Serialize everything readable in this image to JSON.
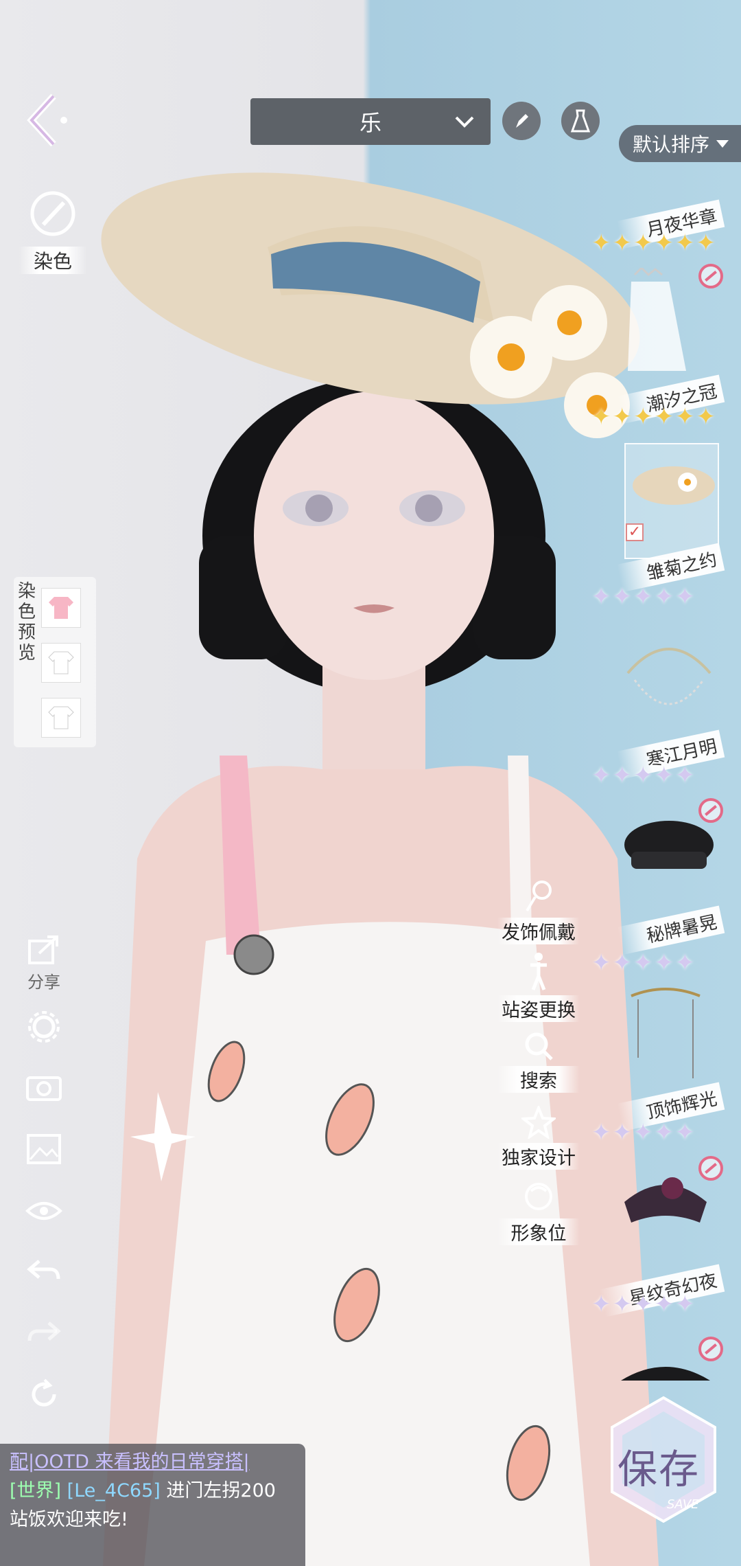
{
  "header": {
    "dropdown_value": "乐",
    "sort_label": "默认排序"
  },
  "left_panel": {
    "dye_label": "染色",
    "dye_preview_label": "染色预览",
    "share_label": "分享"
  },
  "feature_menu": [
    {
      "label": "发饰佩戴",
      "icon": "hairpin-icon"
    },
    {
      "label": "站姿更换",
      "icon": "pose-icon"
    },
    {
      "label": "搜索",
      "icon": "search-icon"
    },
    {
      "label": "独家设计",
      "icon": "star-icon"
    },
    {
      "label": "形象位",
      "icon": "avatar-icon"
    }
  ],
  "items": [
    {
      "name": "月夜华章",
      "rarity": 6,
      "star_color": "gold",
      "locked": true
    },
    {
      "name": "潮汐之冠",
      "rarity": 6,
      "star_color": "gold",
      "locked": false
    },
    {
      "name": "雏菊之约",
      "rarity": 5,
      "star_color": "silver",
      "locked": false,
      "selected": true
    },
    {
      "name": "寒江月明",
      "rarity": 5,
      "star_color": "silver",
      "locked": true
    },
    {
      "name": "秘牌暑晃",
      "rarity": 5,
      "star_color": "silver",
      "locked": false
    },
    {
      "name": "顶饰辉光",
      "rarity": 5,
      "star_color": "silver",
      "locked": true
    },
    {
      "name": "星纹奇幻夜",
      "rarity": 5,
      "star_color": "silver",
      "locked": true
    }
  ],
  "chat": {
    "line1": "配|OOTD 来看我的日常穿搭|",
    "channel": "[世界]",
    "user": "[Le_4C65]",
    "line2_msg": "进门左拐200",
    "line3": "站饭欢迎来吃!"
  },
  "save_button": {
    "label": "保存",
    "sub": "SAVE"
  }
}
